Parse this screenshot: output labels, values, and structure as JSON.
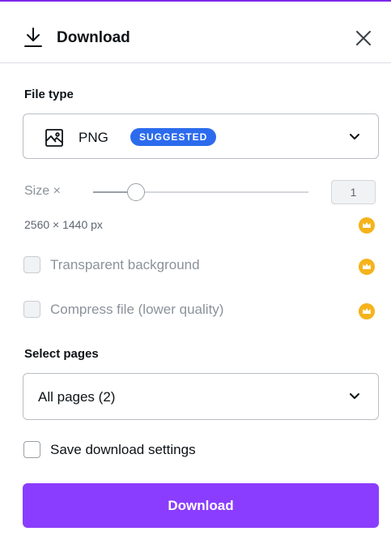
{
  "header": {
    "title": "Download",
    "download_icon": "download-icon",
    "close_icon": "close-icon"
  },
  "file_type": {
    "label": "File type",
    "selected": "PNG",
    "badge": "SUGGESTED",
    "icon": "image-icon"
  },
  "size": {
    "label": "Size ×",
    "value": "1",
    "slider_fraction": 0.2,
    "dimensions": "2560 × 1440 px"
  },
  "options": {
    "transparent_background": "Transparent background",
    "compress_file": "Compress file (lower quality)",
    "premium_icon": "crown-icon"
  },
  "pages": {
    "label": "Select pages",
    "selected": "All pages (2)"
  },
  "save_settings": {
    "label": "Save download settings",
    "checked": false
  },
  "download_button": {
    "label": "Download"
  },
  "colors": {
    "accent": "#8b3dff",
    "badge": "#2c6bed",
    "crown": "#f5b31b",
    "top_line": "#7d2ae8"
  }
}
